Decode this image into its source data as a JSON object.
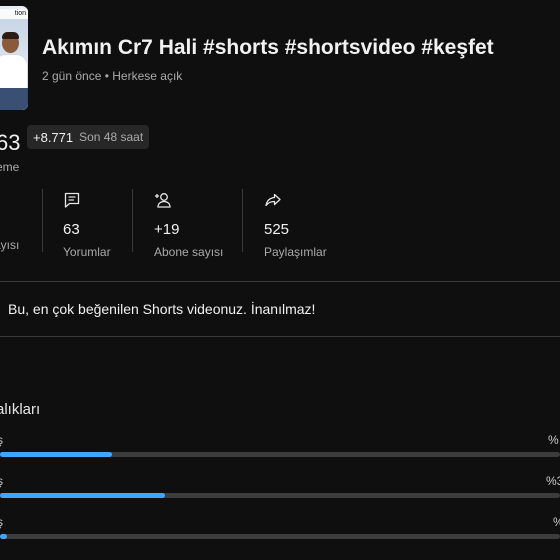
{
  "video": {
    "thumb_caption": "tion",
    "title": "Akımın Cr7 Hali #shorts #shortsvideo #keşfet",
    "meta": "2 gün önce • Herkese açık"
  },
  "views": {
    "count_partial": "63",
    "increase": "+8.771",
    "period": "Son 48 saat",
    "label_partial": "eme"
  },
  "stats": {
    "first_label_partial": "ayısı",
    "items": [
      {
        "icon": "comment-icon",
        "value": "63",
        "label": "Yorumlar"
      },
      {
        "icon": "add-subscriber-icon",
        "value": "+19",
        "label": "Abone sayısı"
      },
      {
        "icon": "share-icon",
        "value": "525",
        "label": "Paylaşımlar"
      }
    ]
  },
  "banner": {
    "text": "Bu, en çok beğenilen Shorts videonuz. İnanılmaz!"
  },
  "breakdown": {
    "title_partial": "alıkları",
    "rows": [
      {
        "left": "ş",
        "right": "%",
        "fraction": 0.2
      },
      {
        "left": "ş",
        "right": "%3",
        "fraction": 0.295
      },
      {
        "left": "ş",
        "right": "%",
        "fraction": 0.012
      }
    ]
  },
  "colors": {
    "accent": "#3ea6ff",
    "background": "#0f0f0f",
    "text_secondary": "#aaaaaa"
  }
}
